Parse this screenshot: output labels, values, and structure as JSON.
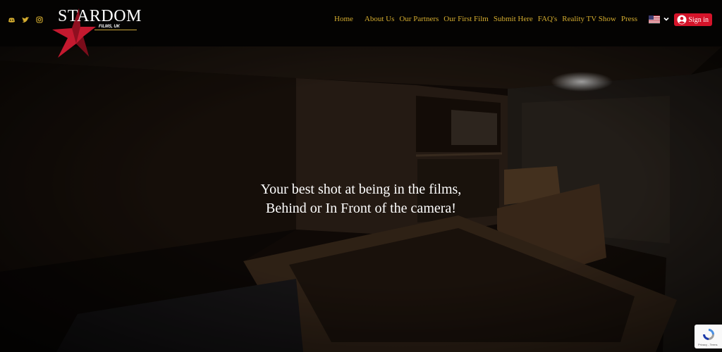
{
  "header": {
    "social_icons": [
      "discord-icon",
      "twitter-icon",
      "instagram-icon"
    ],
    "logo": {
      "wordmark": "STARDOM",
      "subtitle": "FILMS, UK"
    },
    "nav": [
      "Home",
      "About Us",
      "Our Partners",
      "Our First Film",
      "Submit Here",
      "FAQ's",
      "Reality TV Show",
      "Press"
    ],
    "language_flag": "us-flag-icon",
    "signin_label": "Sign in"
  },
  "hero": {
    "tagline_line1": "Your best shot at being in the films,",
    "tagline_line2": "Behind or In Front of the camera!"
  },
  "recaptcha": {
    "text": "Privacy - Terms"
  },
  "colors": {
    "nav_text": "#d4ac2f",
    "signin_bg": "#d4142a",
    "star": "#c4192f",
    "header_bg": "#040302"
  }
}
